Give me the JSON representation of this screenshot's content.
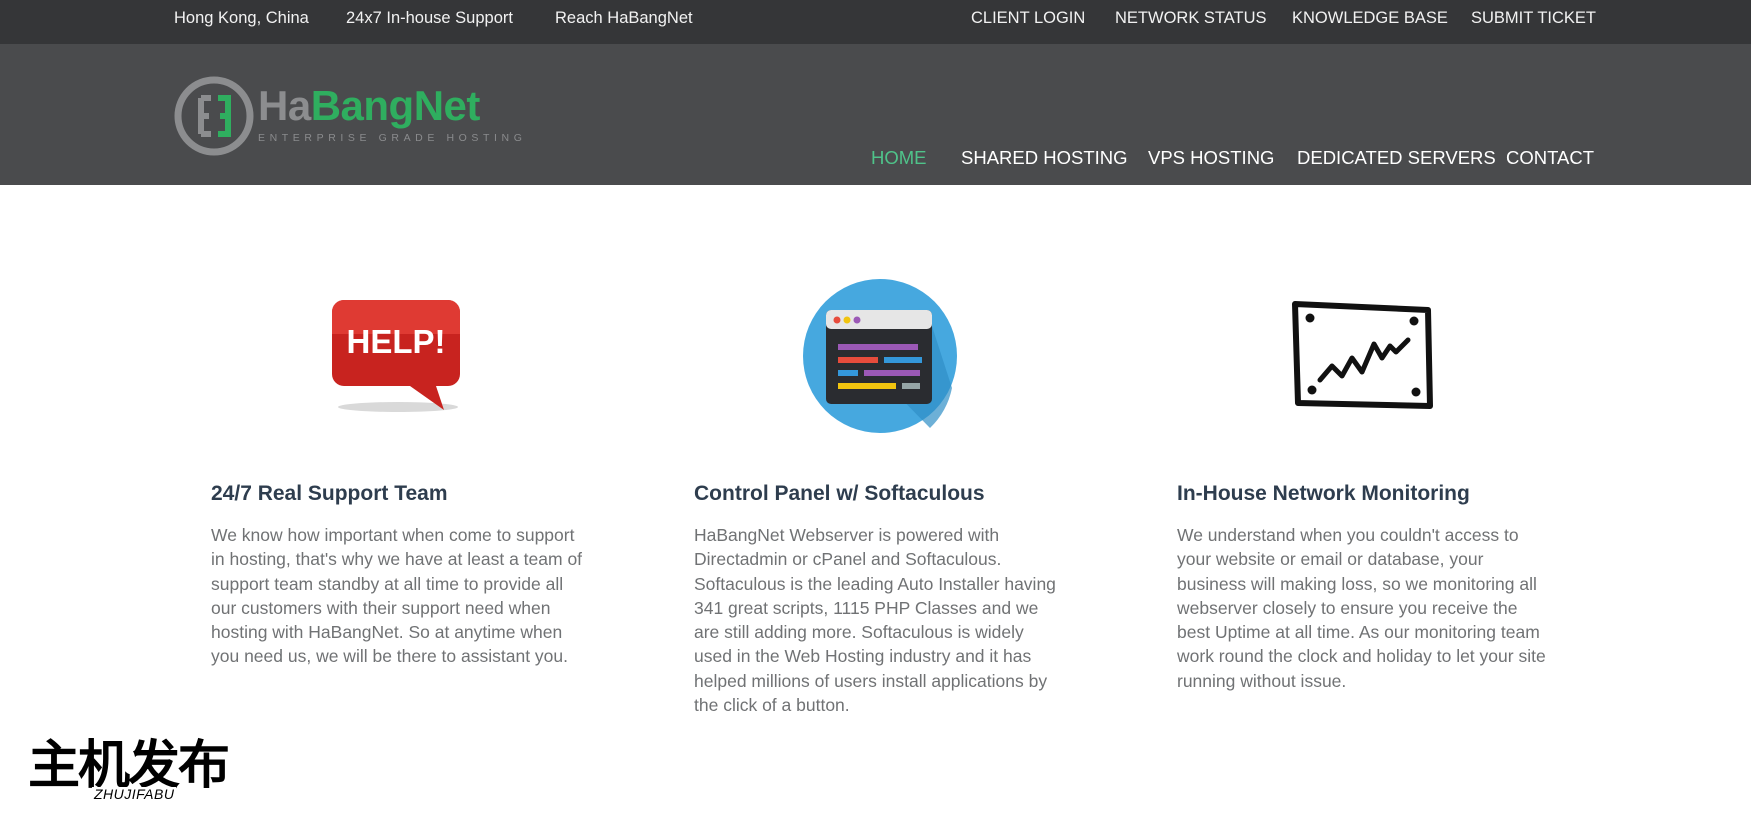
{
  "topbar": {
    "left": [
      "Hong Kong, China",
      "24x7 In-house Support",
      "Reach HaBangNet"
    ],
    "right": [
      "CLIENT LOGIN",
      "NETWORK STATUS",
      "KNOWLEDGE BASE",
      "SUBMIT TICKET"
    ]
  },
  "logo": {
    "brand_part1": "Ha",
    "brand_part2": "BangNet",
    "tagline": "ENTERPRISE GRADE HOSTING",
    "colors": {
      "gray": "#8c8d8f",
      "green": "#2fae5f"
    }
  },
  "nav": {
    "items": [
      "HOME",
      "SHARED HOSTING",
      "VPS HOSTING",
      "DEDICATED SERVERS",
      "CONTACT"
    ],
    "active_index": 0,
    "active_color": "#4fc38a"
  },
  "features": [
    {
      "icon": "help-speech-bubble-icon",
      "icon_text": "HELP!",
      "title": "24/7 Real Support Team",
      "body": "We know how important when come to support in hosting, that's why we have at least a team of support team standby at all time to provide all our customers with their support need when hosting with HaBangNet. So at anytime when you need us, we will be there to assistant you."
    },
    {
      "icon": "control-panel-window-icon",
      "title": "Control Panel w/ Softaculous",
      "body": "HaBangNet Webserver is powered with Directadmin or cPanel and Softaculous. Softaculous is the leading Auto Installer having 341 great scripts, 1115 PHP Classes and we are still adding more. Softaculous is widely used in the Web Hosting industry and it has helped millions of users install applications by the click of a button."
    },
    {
      "icon": "network-monitor-chart-icon",
      "title": "In-House Network Monitoring",
      "body": "We understand when you couldn't access to your website or email or database, your business will making loss, so we monitoring all webserver closely to ensure you receive the best Uptime at all time. As our monitoring team work round the clock and holiday to let your site running without issue."
    }
  ],
  "watermark": {
    "cn": "主机发布",
    "pinyin": "ZHUJIFABU"
  }
}
